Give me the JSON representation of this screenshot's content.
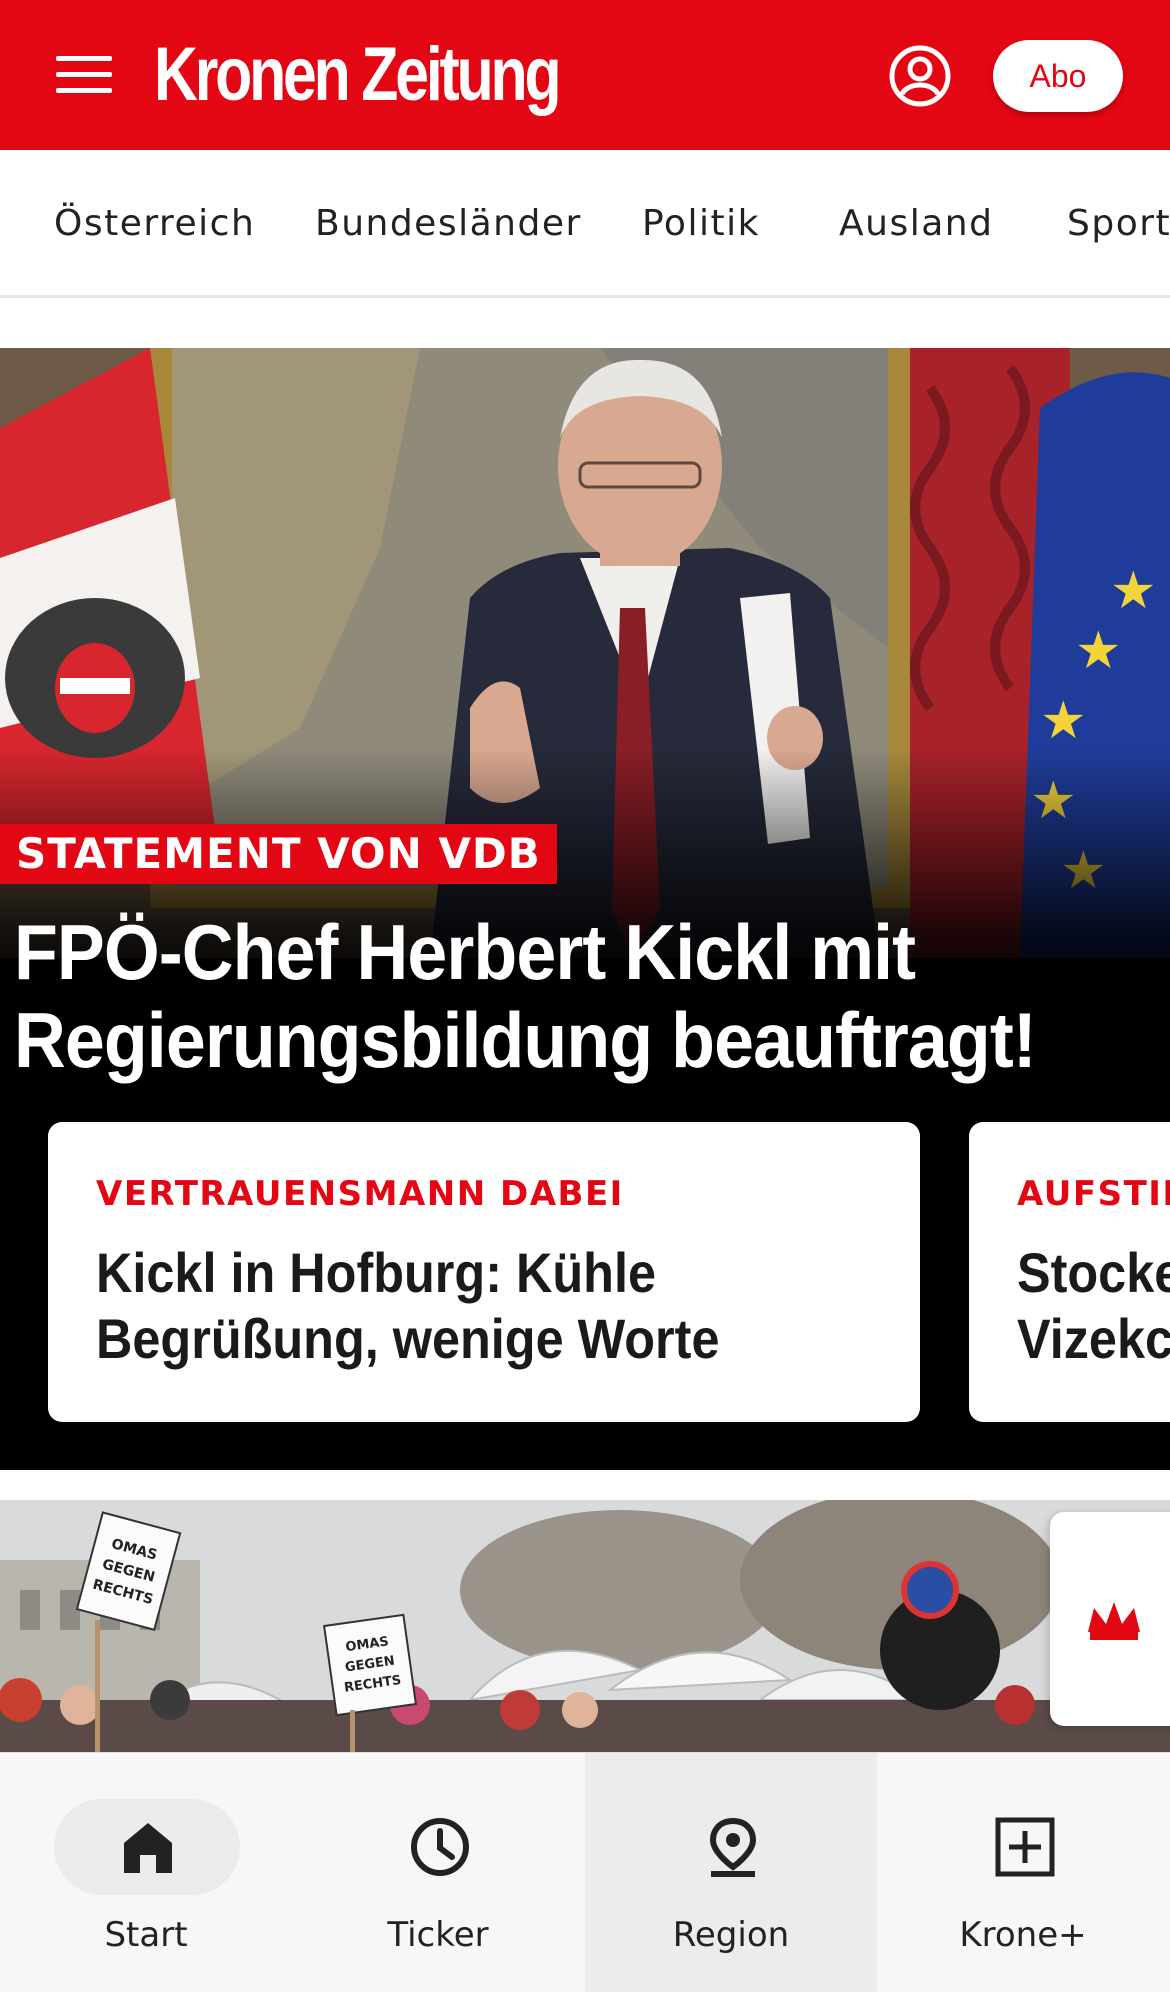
{
  "colors": {
    "brand_red": "#e30613",
    "hero_bg": "#000000",
    "text_dark": "#1a1a1a"
  },
  "header": {
    "menu_icon": "hamburger-menu-icon",
    "logo": "Kronen Zeitung",
    "user_icon": "account-icon",
    "abo_label": "Abo"
  },
  "categories": [
    "Österreich",
    "Bundesländer",
    "Politik",
    "Ausland",
    "Sport"
  ],
  "hero": {
    "kicker": "STATEMENT VON VDB",
    "headline": "FPÖ-Chef Herbert Kickl mit Regierungsbildung beauftragt!"
  },
  "cards": [
    {
      "kicker": "VERTRAUENSMANN DABEI",
      "title_line1": "Kickl in Hofburg: Kühle",
      "title_line2": "Begrüßung, wenige Worte"
    },
    {
      "kicker": "AUFSTIE",
      "title_line1": "Stocke",
      "title_line2": "Vizekc"
    }
  ],
  "story2": {
    "sign_text": "OMAS GEGEN RECHTS"
  },
  "bottom_nav": [
    {
      "label": "Start",
      "icon": "home-icon",
      "selected": true
    },
    {
      "label": "Ticker",
      "icon": "clock-icon",
      "selected": false
    },
    {
      "label": "Region",
      "icon": "location-pin-icon",
      "selected": false
    },
    {
      "label": "Krone+",
      "icon": "plus-box-icon",
      "selected": false
    }
  ]
}
